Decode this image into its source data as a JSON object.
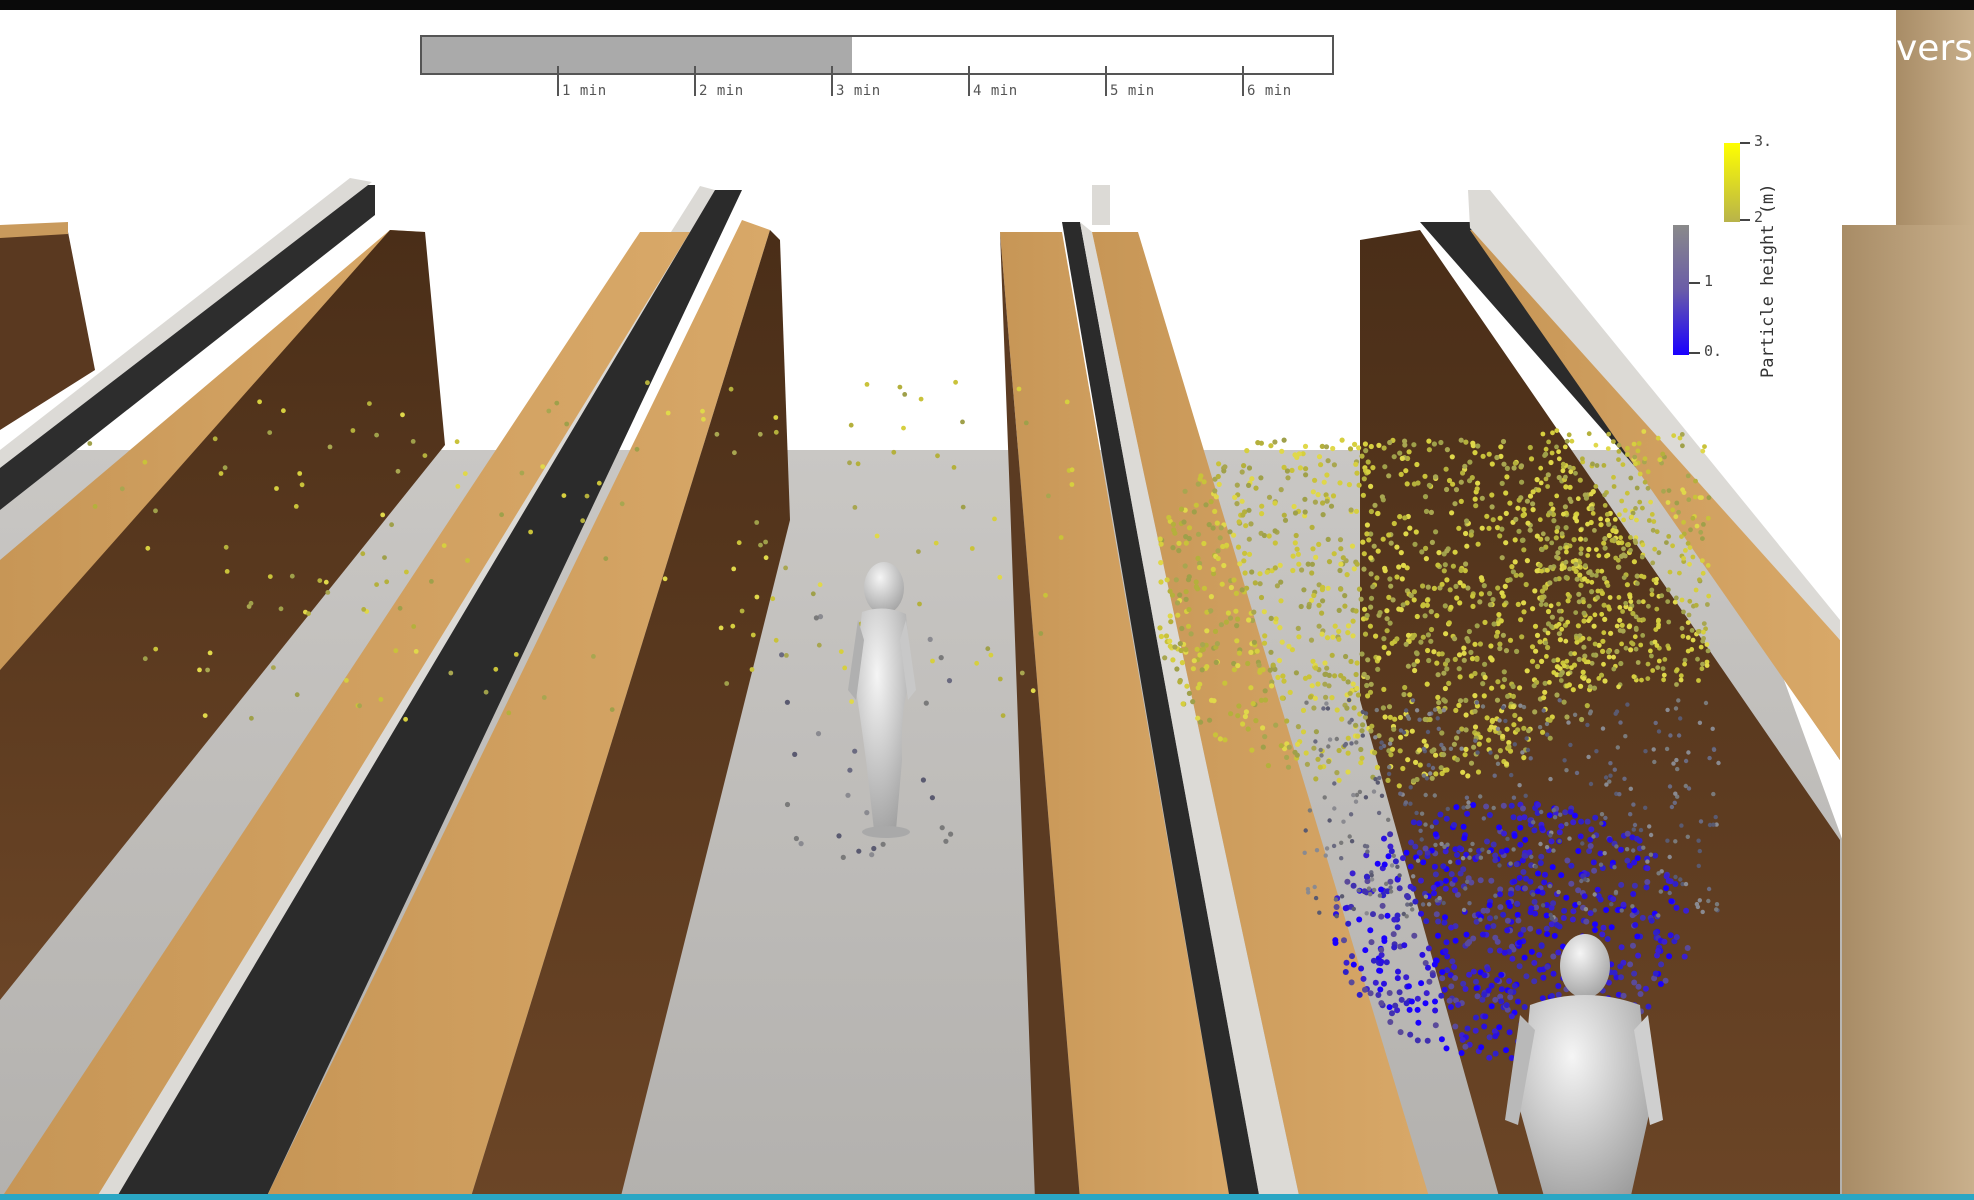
{
  "timeline": {
    "progress_fraction": 0.472,
    "ticks": [
      "1 min",
      "2 min",
      "3 min",
      "4 min",
      "5 min",
      "6 min"
    ]
  },
  "colorbar": {
    "title": "Particle height (m)",
    "tick_labels": [
      "3.",
      "2",
      "1",
      "0."
    ],
    "colors": {
      "top": "#ffff00",
      "mid": "#7a7a7a",
      "bottom": "#1a00ff"
    }
  },
  "overlay_text": "ivers",
  "colors": {
    "wall_top": "#c99a5c",
    "wall_side": "#5a3a22",
    "floor": "#bdbbb8",
    "screen_dark": "#2b2b2b",
    "shelf_light": "#dcdad6",
    "panel_right": "#b9a07a"
  }
}
